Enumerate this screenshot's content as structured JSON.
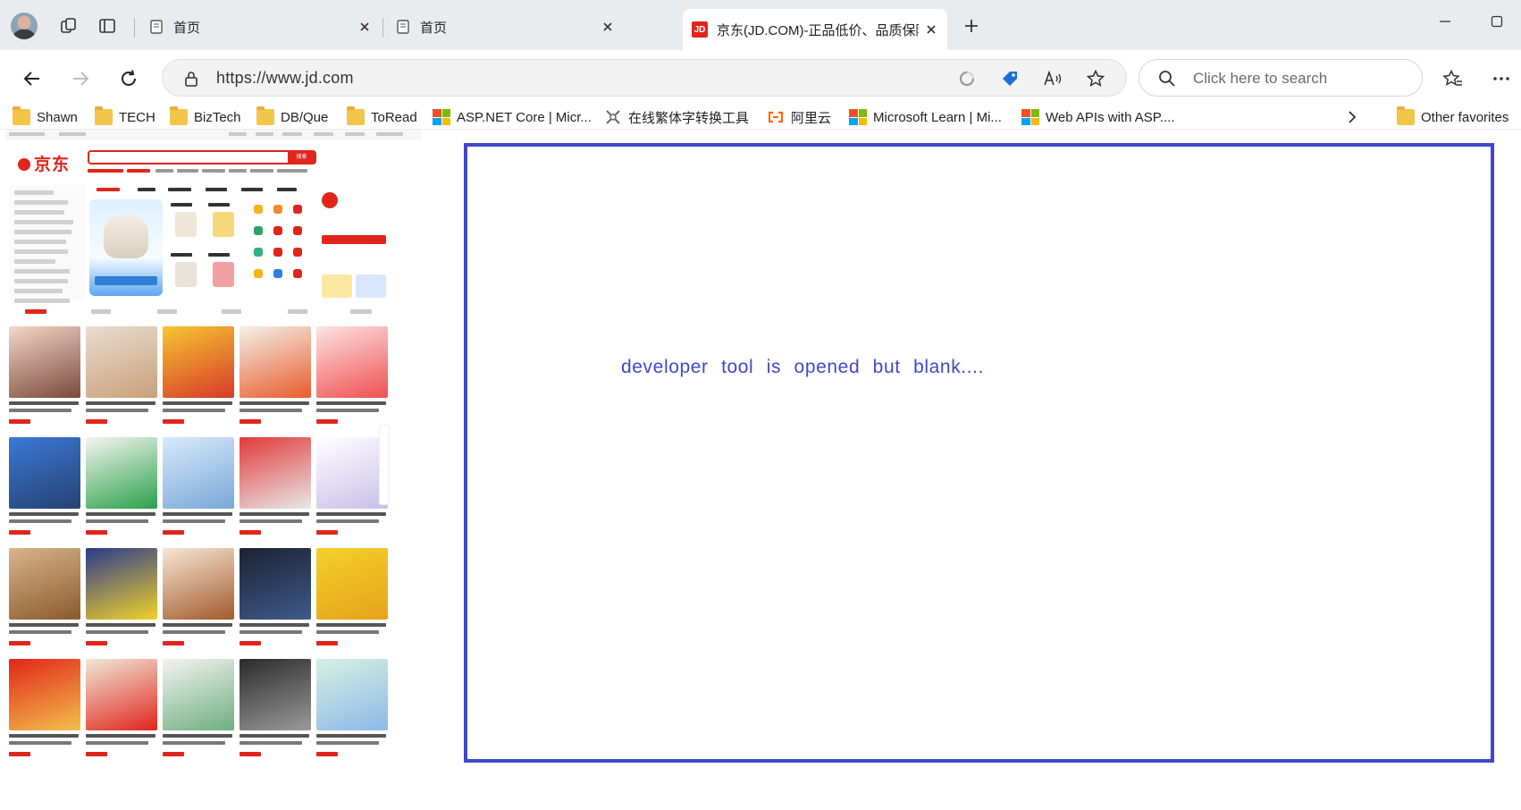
{
  "tabs": [
    {
      "title": "首页",
      "active": false
    },
    {
      "title": "首页",
      "active": false
    },
    {
      "title": "京东(JD.COM)-正品低价、品质保障",
      "active": true
    }
  ],
  "active_tab_favicon": "JD",
  "address": {
    "url": "https://www.jd.com"
  },
  "search": {
    "placeholder": "Click here to search"
  },
  "bookmarks": [
    {
      "label": "Shawn",
      "icon": "folder-icon"
    },
    {
      "label": "TECH",
      "icon": "folder-icon"
    },
    {
      "label": "BizTech",
      "icon": "folder-icon"
    },
    {
      "label": "DB/Que",
      "icon": "folder-icon"
    },
    {
      "label": "ToRead",
      "icon": "folder-icon"
    },
    {
      "label": "ASP.NET Core | Micr...",
      "icon": "microsoft-logo-icon"
    },
    {
      "label": "在线繁体字转换工具",
      "icon": "tool-icon"
    },
    {
      "label": "阿里云",
      "icon": "aliyun-icon"
    },
    {
      "label": "Microsoft Learn | Mi...",
      "icon": "microsoft-logo-icon"
    },
    {
      "label": "Web APIs with ASP....",
      "icon": "microsoft-logo-icon"
    }
  ],
  "other_favorites": "Other favorites",
  "jd": {
    "logo_text": "京东",
    "search_button": "搜索"
  },
  "devtools": {
    "message": "developer tool is opened but blank....",
    "border_color": "#3f48cc"
  },
  "colors": {
    "jd_red": "#e1251b",
    "tabstrip_bg": "#e9ecef"
  }
}
